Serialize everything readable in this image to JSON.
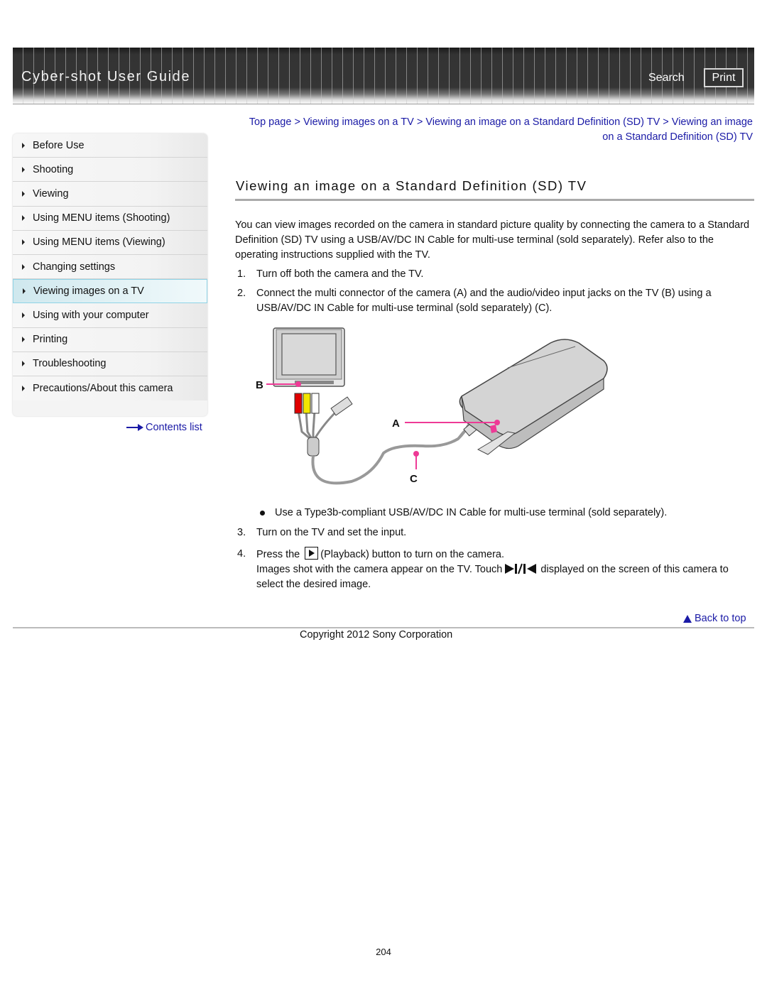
{
  "header": {
    "title": "Cyber-shot User Guide",
    "search_label": "Search",
    "print_label": "Print"
  },
  "sidebar": {
    "items": [
      {
        "label": "Before Use",
        "icon": "triangle-right-icon",
        "active": false
      },
      {
        "label": "Shooting",
        "icon": "triangle-right-icon",
        "active": false
      },
      {
        "label": "Viewing",
        "icon": "triangle-right-icon",
        "active": false
      },
      {
        "label": "Using MENU items (Shooting)",
        "icon": "triangle-right-icon",
        "active": false
      },
      {
        "label": "Using MENU items (Viewing)",
        "icon": "triangle-right-icon",
        "active": false
      },
      {
        "label": "Changing settings",
        "icon": "triangle-right-icon",
        "active": false
      },
      {
        "label": "Viewing images on a TV",
        "icon": "triangle-right-icon",
        "active": true
      },
      {
        "label": "Using with your computer",
        "icon": "triangle-right-icon",
        "active": false
      },
      {
        "label": "Printing",
        "icon": "triangle-right-icon",
        "active": false
      },
      {
        "label": "Troubleshooting",
        "icon": "triangle-right-icon",
        "active": false
      },
      {
        "label": "Precautions/About this camera",
        "icon": "triangle-right-icon",
        "active": false
      }
    ],
    "contents_link": "Contents list"
  },
  "breadcrumb": {
    "items": [
      "Top page",
      "Viewing images on a TV",
      "Viewing an image on a Standard Definition (SD) TV",
      "Viewing an image on a Standard Definition (SD) TV"
    ],
    "separator": " > "
  },
  "main": {
    "title": "Viewing an image on a Standard Definition (SD) TV",
    "intro": "You can view images recorded on the camera in standard picture quality by connecting the camera to a Standard Definition (SD) TV using a USB/AV/DC IN Cable for multi-use terminal (sold separately). Refer also to the operating instructions supplied with the TV.",
    "steps": [
      {
        "num": "1.",
        "text": "Turn off both the camera and the TV."
      },
      {
        "num": "2.",
        "text": "Connect the multi connector of the camera (A) and the audio/video input jacks on the TV (B) using a USB/AV/DC IN Cable for multi-use terminal (sold separately) (C)."
      },
      {
        "num": "3.",
        "text": "Turn on the TV and set the input."
      },
      {
        "num": "4.",
        "text_before_icon": "Press the",
        "text_after_icon": "(Playback) button to turn on the camera.",
        "line2_before_icon": "Images shot with the camera appear on the TV. Touch",
        "line2_after_icon": "displayed on the screen of this camera to select the desired image."
      }
    ],
    "note": "Use a Type3b-compliant USB/AV/DC IN Cable for multi-use terminal (sold separately).",
    "diagram": {
      "labels": {
        "a": "A",
        "b": "B",
        "c": "C"
      },
      "callout_color": "#ee3a96"
    }
  },
  "footer": {
    "back_to_top": "Back to top",
    "copyright": "Copyright 2012 Sony Corporation",
    "page_number": "204"
  },
  "colors": {
    "link": "#1a1aa6",
    "header_bg": "#333333",
    "active_item_bg": "#d8eef3",
    "active_item_border": "#8fd3e6"
  }
}
